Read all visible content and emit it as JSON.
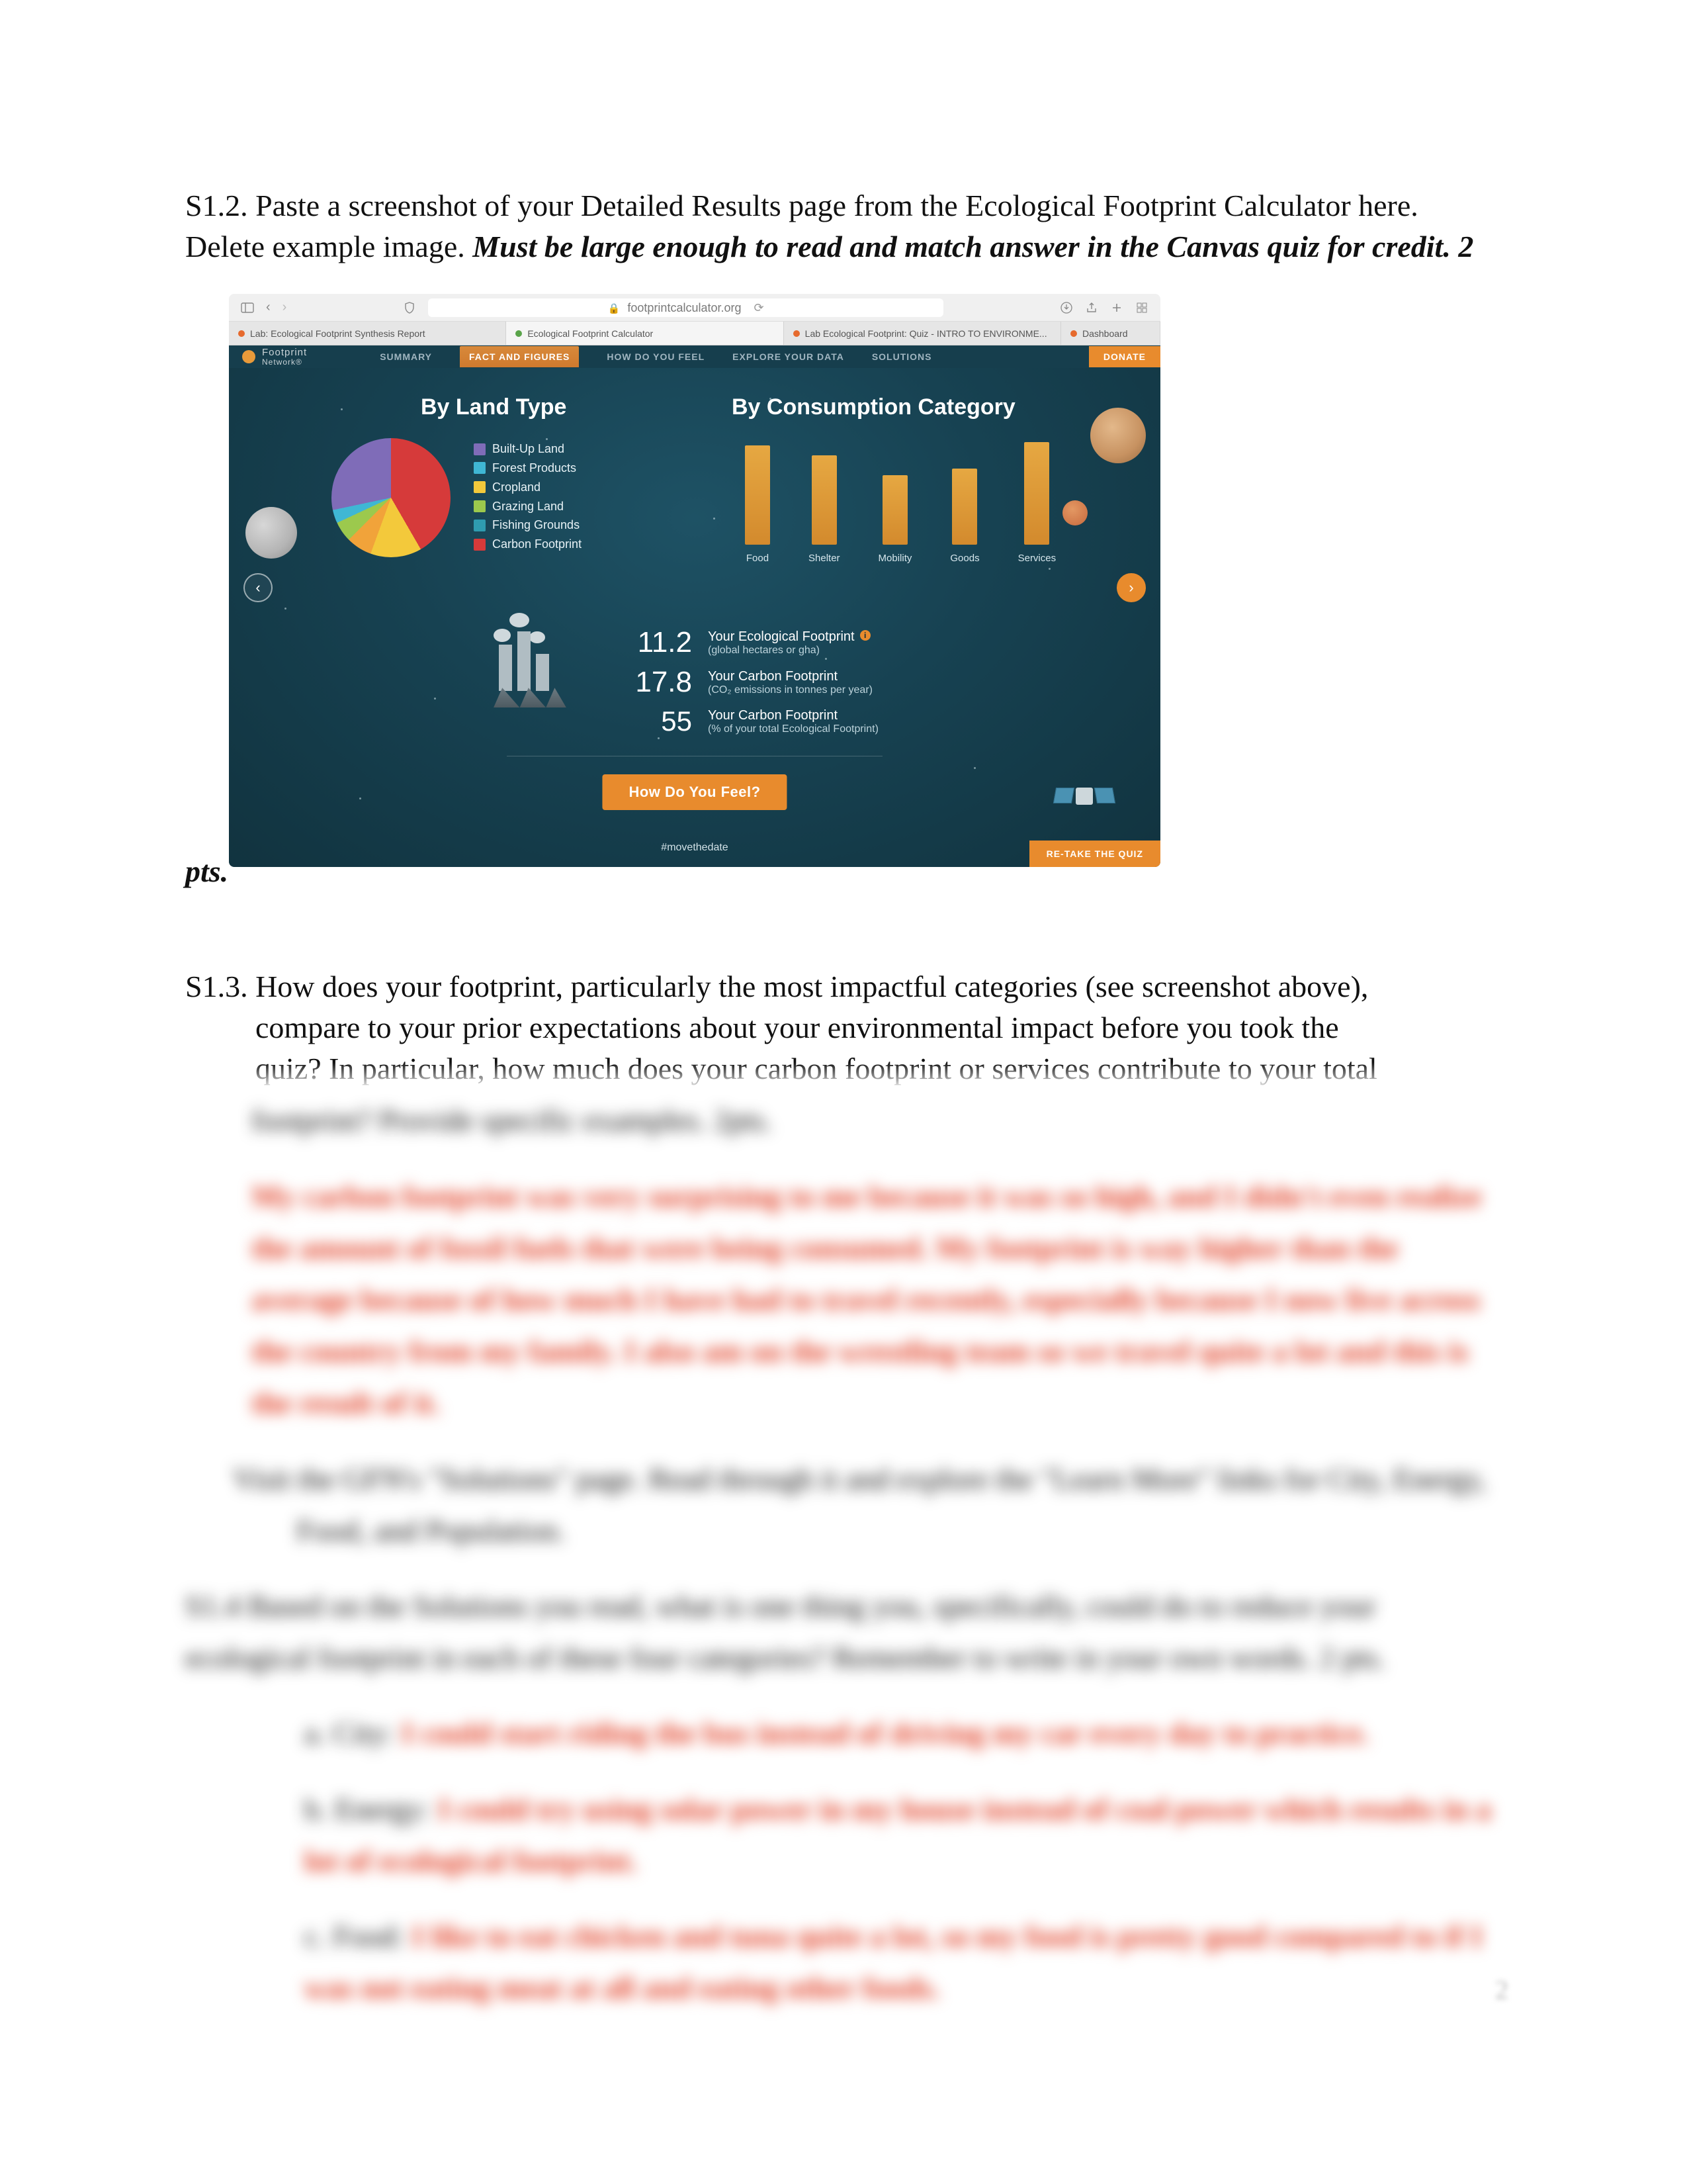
{
  "doc": {
    "q12_a": "S1.2. Paste a screenshot of your Detailed Results page from the Ecological Footprint Calculator here. Delete example image. ",
    "q12_b": "Must be large enough to read and match answer in the Canvas quiz for credit. 2",
    "pts": "pts.",
    "q13_line1": "S1.3. How does your footprint, particularly the most impactful categories (see screenshot above),",
    "q13_line2": "compare to your prior expectations about your environmental impact before you took the",
    "q13_line3": "quiz? In particular, how much does your carbon footprint or services contribute to your total",
    "page_num": "2"
  },
  "browser": {
    "addr": "footprintcalculator.org",
    "tabs": {
      "t0": "Lab: Ecological Footprint Synthesis Report",
      "t1": "Ecological Footprint Calculator",
      "t2": "Lab Ecological Footprint: Quiz - INTRO TO ENVIRONME...",
      "t3": "Dashboard"
    }
  },
  "site": {
    "logo_a": "Footprint",
    "logo_b": "Network®",
    "nav": {
      "summary": "SUMMARY",
      "facts": "FACT AND FIGURES",
      "feel": "HOW DO YOU FEEL",
      "explore": "EXPLORE YOUR DATA",
      "solutions": "SOLUTIONS"
    },
    "donate": "DONATE"
  },
  "results": {
    "hdr_land": "By Land Type",
    "hdr_cons": "By Consumption Category",
    "legend": {
      "l0": "Built-Up Land",
      "l1": "Forest Products",
      "l2": "Cropland",
      "l3": "Grazing Land",
      "l4": "Fishing Grounds",
      "l5": "Carbon Footprint"
    },
    "bars": {
      "b0": "Food",
      "b1": "Shelter",
      "b2": "Mobility",
      "b3": "Goods",
      "b4": "Services"
    },
    "stats": {
      "n0": "11.2",
      "t0": "Your Ecological Footprint",
      "s0": "(global hectares or gha)",
      "n1": "17.8",
      "t1": "Your Carbon Footprint",
      "s1": "(CO₂ emissions in tonnes per year)",
      "n2": "55",
      "t2": "Your Carbon Footprint",
      "s2": "(% of your total Ecological Footprint)"
    },
    "feel_btn": "How Do You Feel?",
    "hashtag": "#movethedate",
    "retake": "RE-TAKE THE QUIZ"
  },
  "blur": {
    "tail": "footprint? Provide specific examples.  2pts.",
    "ans": "My carbon footprint was very surprising to me because it was so high, and I didn't even realize the amount of fossil fuels that were being consumed. My footprint is way higher than the average because of how much I have had to travel recently, especially because I now live across the country from my family. I also am on the wrestling team so we travel quite a lot and this is the result of it.",
    "visit": "Visit the GFN's \"Solutions\" page. Read through it and explore the \"Learn More\" links for City, Energy, Food, and Population.",
    "s14": "S1.4 Based on the Solutions you read, what is one thing you, specifically, could do to reduce your ecological footprint in each of these four categories? Remember to write in your own words. 2 pts.",
    "city_l": "a. City: ",
    "city_a": "I could start riding the bus instead of driving my car every day to practice.",
    "en_l": "b. Energy: ",
    "en_a": "I could try using solar power in my house instead of coal power which results in a lot of ecological footprint.",
    "food_l": "c. Food: ",
    "food_a": "I like to eat chicken and tuna quite a lot, so my food is pretty good compared to if I was not eating meat at all and eating other foods."
  }
}
